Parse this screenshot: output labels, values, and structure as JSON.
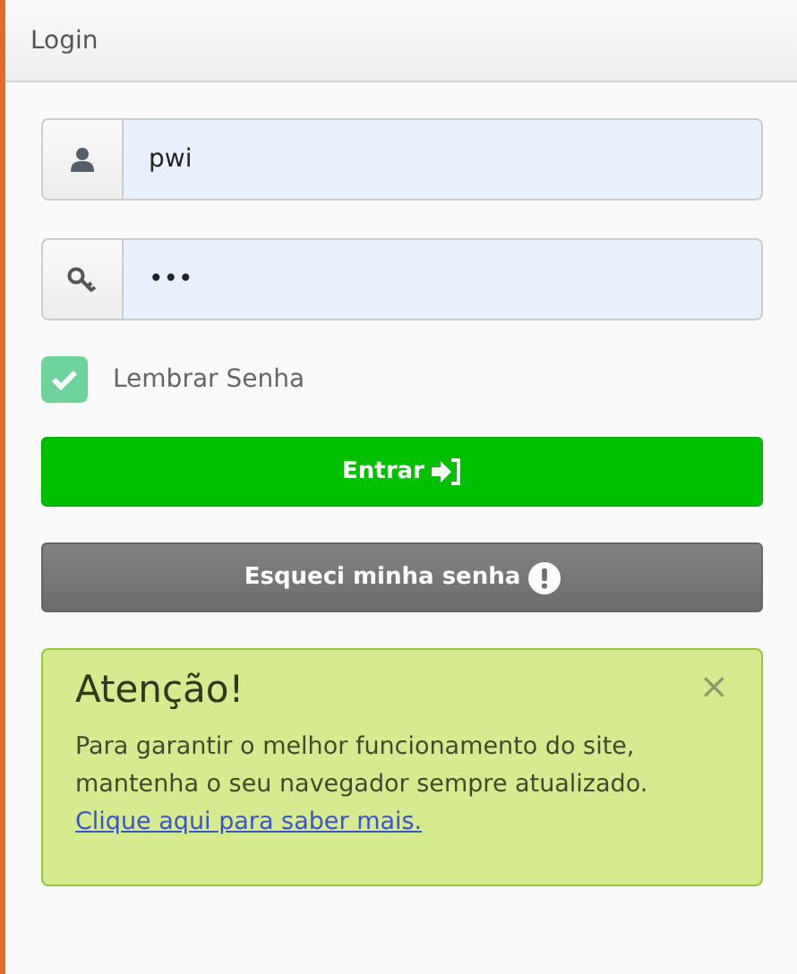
{
  "panel": {
    "title": "Login"
  },
  "fields": [
    {
      "kind": "user",
      "value": "pwi"
    },
    {
      "kind": "key",
      "value": "•••"
    }
  ],
  "remember": {
    "label": "Lembrar Senha",
    "checked": true
  },
  "buttons": [
    {
      "kind": "login",
      "label": "Entrar"
    },
    {
      "kind": "forgot",
      "label": "Esqueci minha senha"
    }
  ],
  "alert": {
    "title": "Atenção!",
    "close": "×",
    "text": "Para garantir o melhor funcionamento do site, mantenha o seu navegador sempre atualizado.",
    "link": "Clique aqui para saber mais."
  }
}
